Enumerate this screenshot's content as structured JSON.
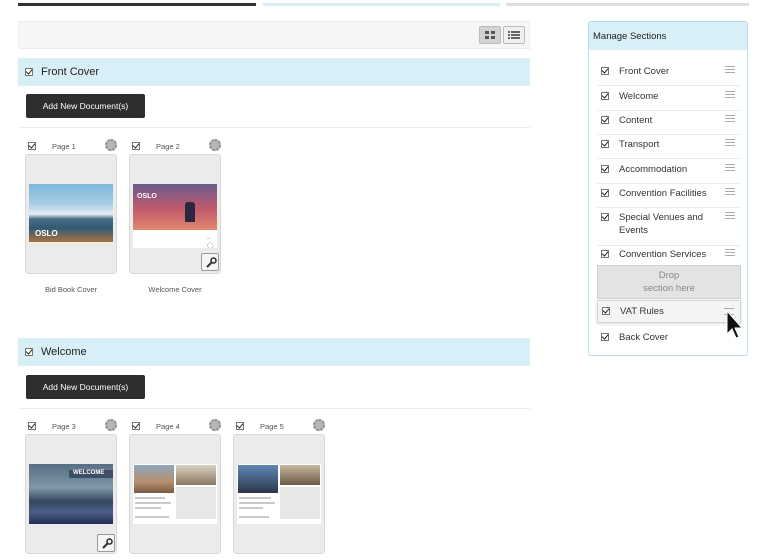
{
  "toolbar": {
    "grid_view_icon": "grid-icon",
    "list_view_icon": "list-icon"
  },
  "sections": [
    {
      "title": "Front Cover",
      "add_button": "Add New Document(s)",
      "pages": [
        {
          "label": "Page 1",
          "caption": "Bid Book Cover",
          "thumb_text": "OSLO"
        },
        {
          "label": "Page 2",
          "caption": "Welcome Cover",
          "thumb_text": "OSLO"
        }
      ]
    },
    {
      "title": "Welcome",
      "add_button": "Add New Document(s)",
      "pages": [
        {
          "label": "Page 3",
          "caption": "",
          "thumb_text": "WELCOME"
        },
        {
          "label": "Page 4",
          "caption": "",
          "thumb_text": ""
        },
        {
          "label": "Page 5",
          "caption": "",
          "thumb_text": ""
        }
      ]
    }
  ],
  "manage_sections": {
    "title": "Manage Sections",
    "items": [
      {
        "label": "Front Cover"
      },
      {
        "label": "Welcome"
      },
      {
        "label": "Content"
      },
      {
        "label": "Transport"
      },
      {
        "label": "Accommodation"
      },
      {
        "label": "Convention Facilities"
      },
      {
        "label": "Special Venues and Events"
      },
      {
        "label": "Convention Services"
      }
    ],
    "dropzone_line1": "Drop",
    "dropzone_line2": "section here",
    "dragging_item": "VAT Rules",
    "last_item": "Back Cover"
  }
}
